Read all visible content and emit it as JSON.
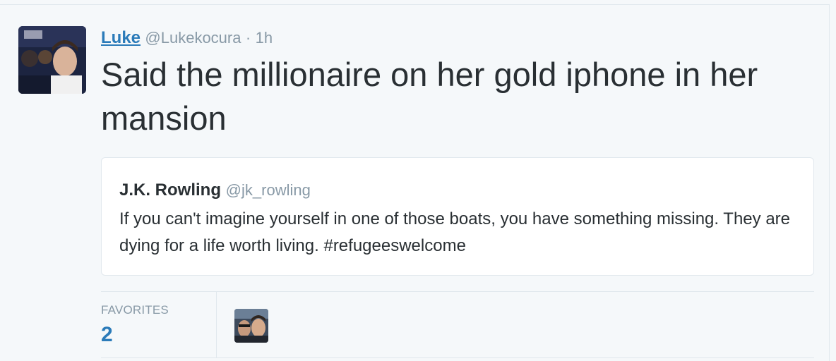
{
  "tweet": {
    "author_name": "Luke",
    "author_handle": "@Lukekocura",
    "separator": "·",
    "time": "1h",
    "text": "Said the millionaire on her gold iphone in her mansion"
  },
  "quoted_tweet": {
    "author_name": "J.K. Rowling",
    "author_handle": "@jk_rowling",
    "text": "If you can't imagine yourself in one of those boats, you have something missing. They are dying for a life worth living. #refugeeswelcome"
  },
  "stats": {
    "favorites_label": "FAVORITES",
    "favorites_count": "2"
  },
  "colors": {
    "link_blue": "#2b7bb9",
    "muted_gray": "#8899a6",
    "text_dark": "#292f33",
    "border": "#e1e8ed",
    "background": "#f5f8fa"
  }
}
